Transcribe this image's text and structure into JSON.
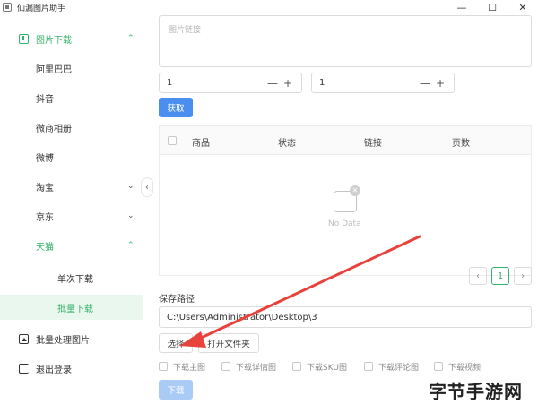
{
  "window": {
    "title": "仙漏图片助手",
    "controls": {
      "minimize": "—",
      "maximize": "☐",
      "close": "✕"
    }
  },
  "sidebar": {
    "collapse_glyph": "‹",
    "items": [
      {
        "label": "图片下载",
        "icon": "download-icon",
        "chevron": "⌃"
      },
      {
        "label": "阿里巴巴"
      },
      {
        "label": "抖音"
      },
      {
        "label": "微商相册"
      },
      {
        "label": "微博"
      },
      {
        "label": "淘宝",
        "chevron": "⌄"
      },
      {
        "label": "京东",
        "chevron": "⌄"
      },
      {
        "label": "天猫",
        "chevron": "⌃"
      },
      {
        "label": "单次下载"
      },
      {
        "label": "批量下载"
      },
      {
        "label": "批量处理图片",
        "icon": "image-icon"
      },
      {
        "label": "退出登录",
        "icon": "exit-icon"
      }
    ]
  },
  "main": {
    "link_placeholder": "图片链接",
    "stepper_left": {
      "value": "1",
      "minus": "—",
      "plus": "+"
    },
    "stepper_right": {
      "value": "1",
      "minus": "—",
      "plus": "+"
    },
    "fetch_button": "获取",
    "table": {
      "columns": [
        "商品",
        "状态",
        "链接",
        "页数"
      ],
      "empty_text": "No Data",
      "empty_badge": "✕"
    },
    "pagination": {
      "prev": "‹",
      "current": "1",
      "next": "›"
    },
    "save_path_label": "保存路径",
    "save_path_value": "C:\\Users\\Administrator\\Desktop\\3",
    "select_button": "选择",
    "open_folder_button": "打开文件夹",
    "options": [
      "下载主图",
      "下载详情图",
      "下载SKU图",
      "下载评论图",
      "下载视频"
    ],
    "download_button": "下载"
  },
  "colors": {
    "accent_green": "#35b26b",
    "primary_blue": "#4a8ef0",
    "arrow_red": "#e8423c"
  },
  "watermark": "字节手游网"
}
